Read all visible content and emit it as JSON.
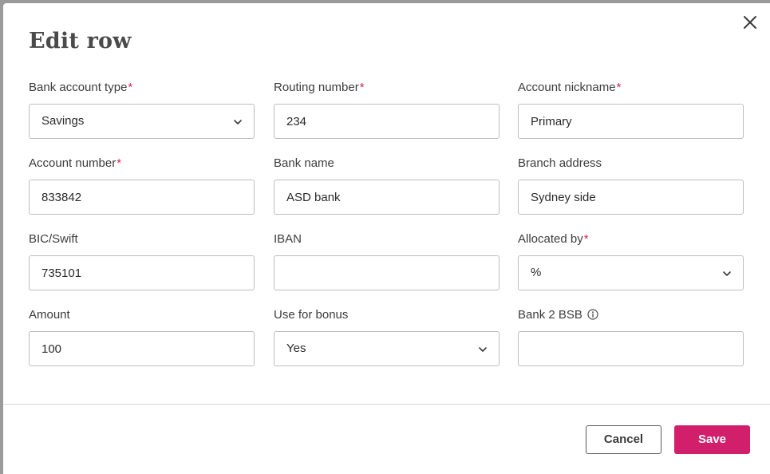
{
  "modal": {
    "title": "Edit row",
    "required_mark": "*"
  },
  "fields": {
    "bank_account_type": {
      "label": "Bank account type",
      "value": "Savings"
    },
    "routing_number": {
      "label": "Routing number",
      "value": "234"
    },
    "account_nickname": {
      "label": "Account nickname",
      "value": "Primary"
    },
    "account_number": {
      "label": "Account number",
      "value": "833842"
    },
    "bank_name": {
      "label": "Bank name",
      "value": "ASD bank"
    },
    "branch_address": {
      "label": "Branch address",
      "value": "Sydney side"
    },
    "bic_swift": {
      "label": "BIC/Swift",
      "value": "735101"
    },
    "iban": {
      "label": "IBAN",
      "value": ""
    },
    "allocated_by": {
      "label": "Allocated by",
      "value": "%"
    },
    "amount": {
      "label": "Amount",
      "value": "100"
    },
    "use_for_bonus": {
      "label": "Use for bonus",
      "value": "Yes"
    },
    "bank_2_bsb": {
      "label": "Bank 2 BSB",
      "value": ""
    }
  },
  "footer": {
    "cancel_label": "Cancel",
    "save_label": "Save"
  },
  "colors": {
    "accent": "#d11f6c",
    "required": "#d9235f"
  },
  "icons": {
    "close": "close-icon",
    "dropdown": "chevron-down-icon",
    "info": "info-icon"
  }
}
